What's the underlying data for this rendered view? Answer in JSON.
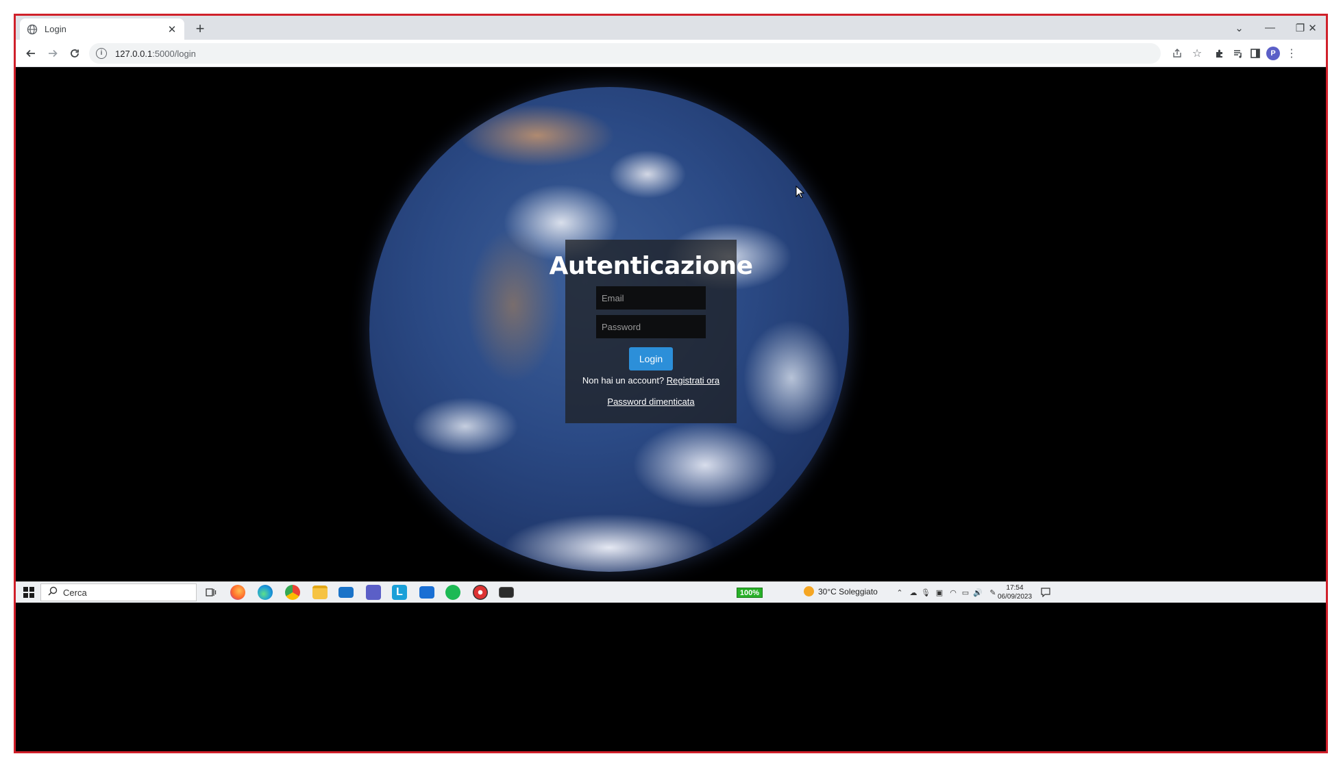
{
  "browser": {
    "tab_title": "Login",
    "new_tab_label": "+",
    "url_host": "127.0.0.1",
    "url_path": ":5000/login",
    "profile_initial": "P"
  },
  "login": {
    "title": "Autenticazione",
    "email_placeholder": "Email",
    "password_placeholder": "Password",
    "login_button": "Login",
    "no_account_text": "Non hai un account? ",
    "register_link": "Registrati ora",
    "forgot_link": "Password dimenticata"
  },
  "taskbar": {
    "search_label": "Cerca",
    "battery": "100%",
    "weather": "30°C  Soleggiato",
    "time": "17:54",
    "date": "06/09/2023"
  },
  "colors": {
    "accent": "#2c8fd9",
    "frame_border": "#d0202a"
  }
}
